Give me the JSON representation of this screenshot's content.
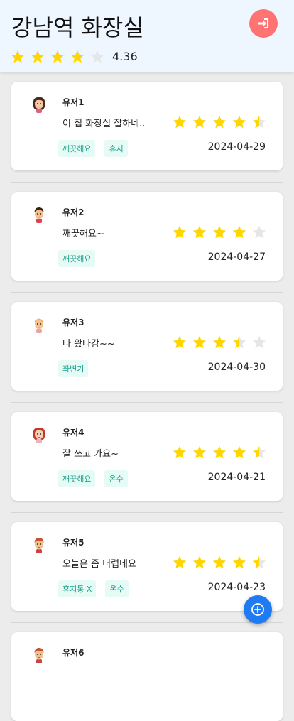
{
  "header": {
    "title": "강남역 화장실",
    "rating": "4.36",
    "rating_value": 4.36,
    "login_icon": "sign-in-icon"
  },
  "colors": {
    "star_gold": "#ffd600",
    "star_gray": "#e6e6e6",
    "login_bg": "#ff7373",
    "fab_bg": "#1e7bf2",
    "tag_bg": "#e6fbf6",
    "tag_text": "#1a9e8a",
    "header_bg": "#eef6ff"
  },
  "reviews": [
    {
      "user": "유저1",
      "comment": "이 집 화장실 잘하네..",
      "rating": 4.5,
      "tags": [
        "깨끗해요",
        "휴지"
      ],
      "date": "2024-04-29",
      "avatar": "woman-icon"
    },
    {
      "user": "유저2",
      "comment": "깨끗해요~",
      "rating": 4,
      "tags": [
        "깨끗해요"
      ],
      "date": "2024-04-27",
      "avatar": "man-icon"
    },
    {
      "user": "유저3",
      "comment": "나 왔다감~~",
      "rating": 3.5,
      "tags": [
        "좌변기"
      ],
      "date": "2024-04-30",
      "avatar": "bald-man-icon"
    },
    {
      "user": "유저4",
      "comment": "잘 쓰고 가요~",
      "rating": 4.5,
      "tags": [
        "깨끗해요",
        "온수"
      ],
      "date": "2024-04-21",
      "avatar": "woman-red-hair-icon"
    },
    {
      "user": "유저5",
      "comment": "오늘은 좀 더럽네요",
      "rating": 4.5,
      "tags": [
        "휴지통 X",
        "온수"
      ],
      "date": "2024-04-23",
      "avatar": "man-ginger-icon"
    },
    {
      "user": "유저6",
      "comment": "",
      "rating": 0,
      "tags": [],
      "date": "",
      "avatar": "man-ginger-icon"
    }
  ],
  "fab": {
    "icon": "add-icon"
  }
}
